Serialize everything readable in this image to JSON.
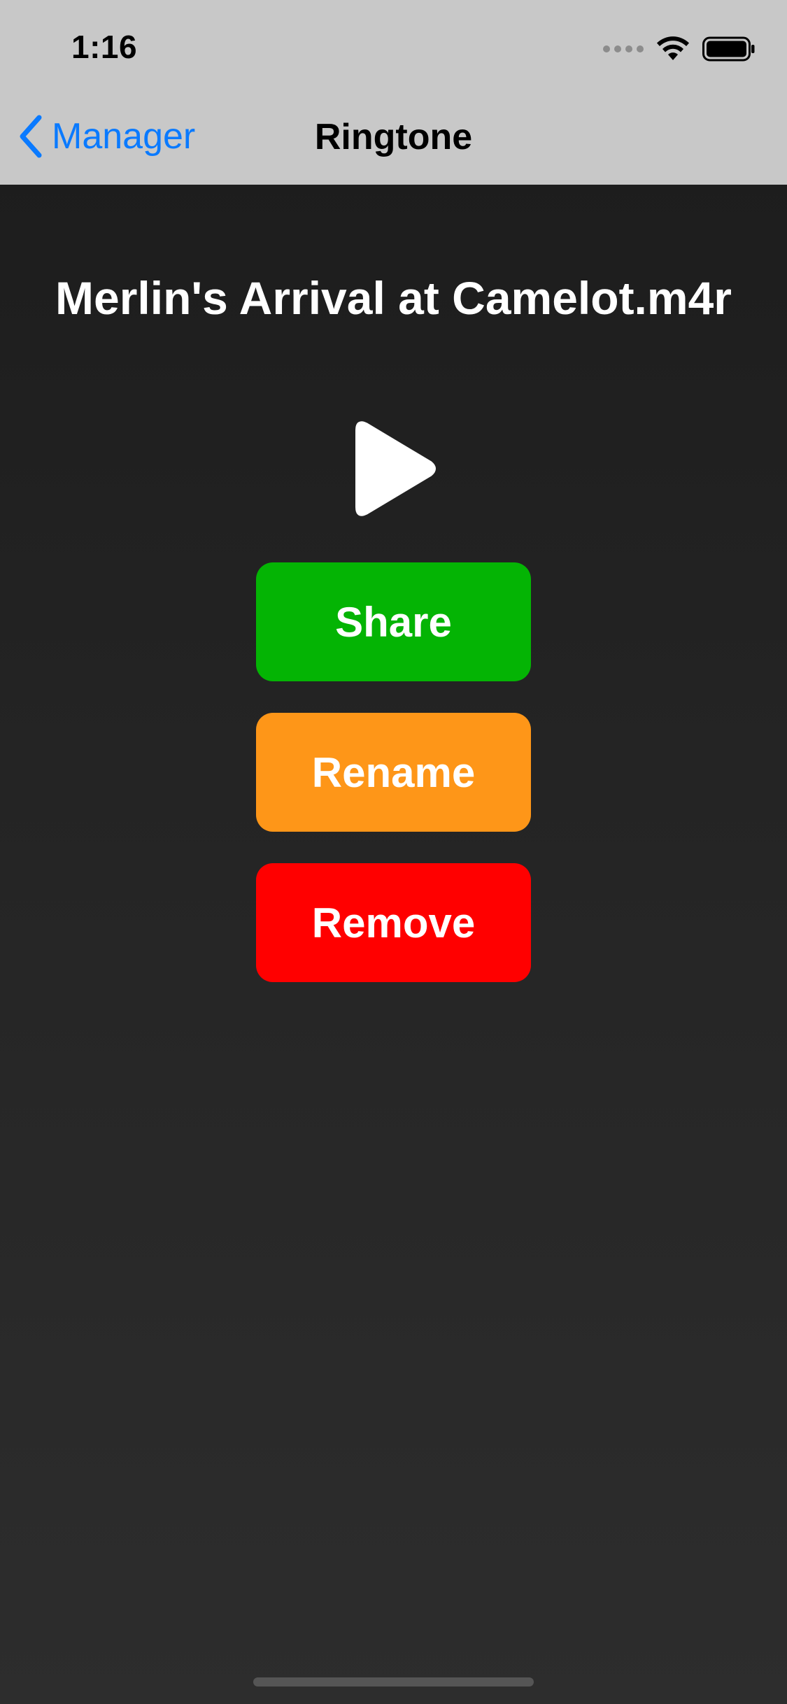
{
  "status_bar": {
    "time": "1:16"
  },
  "nav": {
    "back_label": "Manager",
    "title": "Ringtone"
  },
  "ringtone": {
    "filename": "Merlin's Arrival at Camelot.m4r"
  },
  "actions": {
    "share_label": "Share",
    "rename_label": "Rename",
    "remove_label": "Remove"
  },
  "colors": {
    "accent_blue": "#0a7aff",
    "share": "#04b404",
    "rename": "#fe9618",
    "remove": "#ff0000",
    "bar_background": "#c8c8c8"
  },
  "icons": {
    "back": "chevron-left-icon",
    "play": "play-icon",
    "wifi": "wifi-icon",
    "battery": "battery-icon",
    "signal": "cellular-signal-icon"
  }
}
